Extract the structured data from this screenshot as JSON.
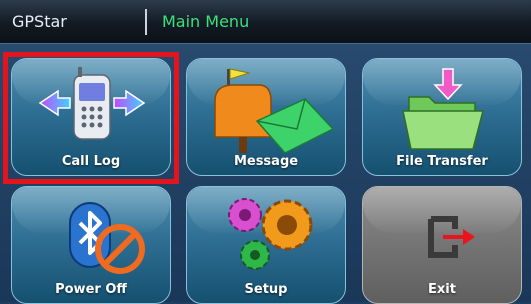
{
  "titlebar": {
    "app_title": "GPStar",
    "menu_title": "Main Menu"
  },
  "menu": {
    "items": [
      {
        "label": "Call Log",
        "icon": "phone-arrows-icon",
        "selected": true
      },
      {
        "label": "Message",
        "icon": "mailbox-envelope-icon"
      },
      {
        "label": "File Transfer",
        "icon": "folder-download-icon"
      },
      {
        "label": "Power Off",
        "icon": "bluetooth-off-icon"
      },
      {
        "label": "Setup",
        "icon": "gears-icon"
      },
      {
        "label": "Exit",
        "icon": "exit-door-icon",
        "style": "gray"
      }
    ]
  },
  "colors": {
    "titlebar_bg": "#121a23",
    "menu_title": "#3de07a",
    "tile_blue": "#2f6f94",
    "tile_gray": "#747474",
    "selection": "#e3141b"
  }
}
